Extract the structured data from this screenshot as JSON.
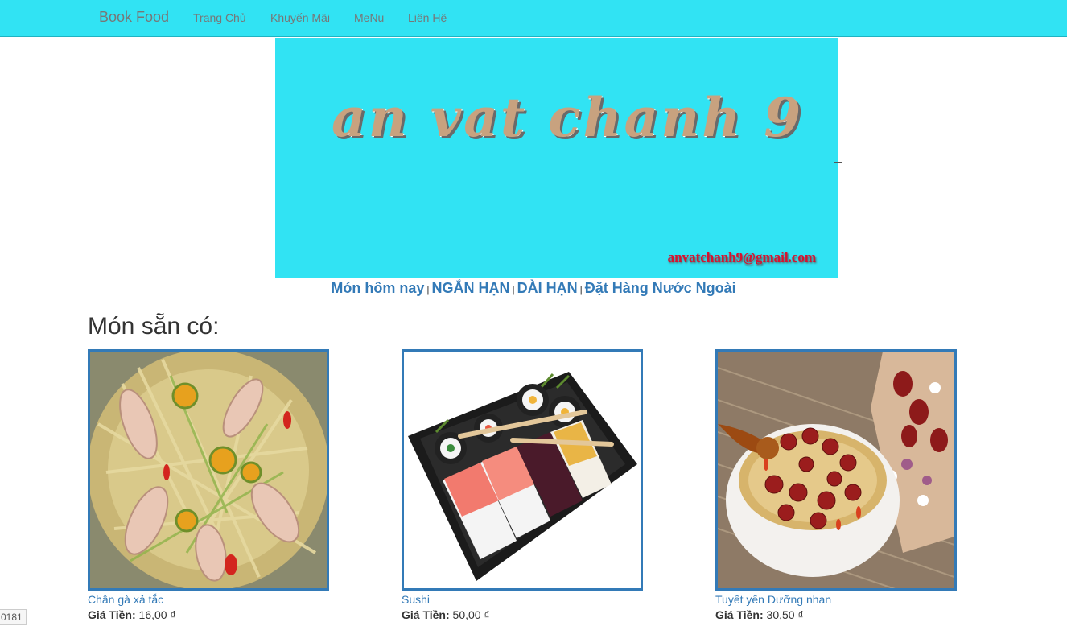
{
  "navbar": {
    "brand": "Book Food",
    "links": [
      "Trang Chủ",
      "Khuyến Mãi",
      "MeNu",
      "Liên Hệ"
    ]
  },
  "banner": {
    "title": "an vat chanh 9",
    "email": "anvatchanh9@gmail.com"
  },
  "subnav": {
    "items": [
      "Món hôm nay",
      "NGẮN HẠN",
      "DÀI HẠN",
      "Đặt Hàng Nước Ngoài"
    ],
    "separator": "|"
  },
  "section": {
    "title": "Món sẵn có:"
  },
  "products": [
    {
      "name": "Chân gà xả tắc",
      "price_label": "Giá Tiền:",
      "price": "16,00 ₫"
    },
    {
      "name": "Sushi",
      "price_label": "Giá Tiền:",
      "price": "50,00 ₫"
    },
    {
      "name": "Tuyết yến Dưỡng nhan",
      "price_label": "Giá Tiền:",
      "price": "30,50 ₫"
    }
  ],
  "corner_tag": "0181",
  "colors": {
    "navbar": "#31e3f3",
    "link": "#337ab7",
    "card_border": "#337ab7"
  }
}
